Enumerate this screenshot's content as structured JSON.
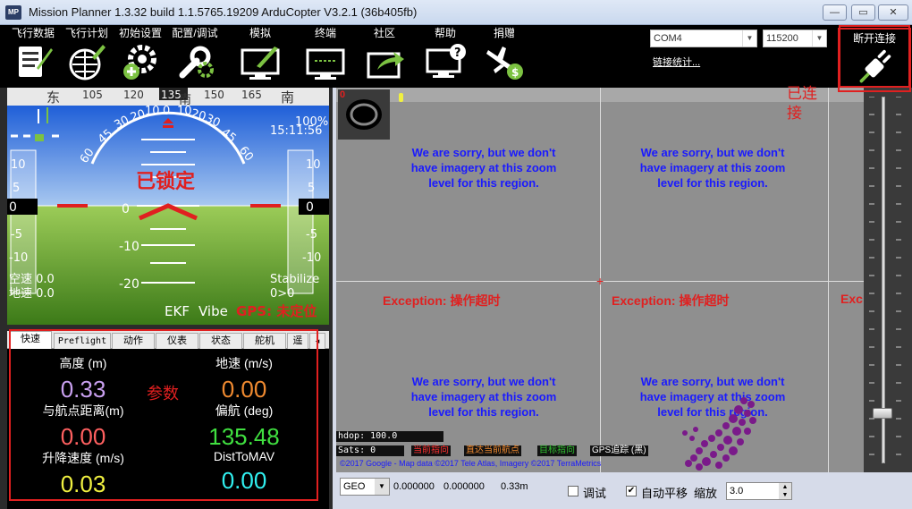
{
  "window": {
    "title": "Mission Planner 1.3.32 build 1.1.5765.19209 ArduCopter V3.2.1 (36b405fb)",
    "icon_text": "MP",
    "minimize": "—",
    "maximize": "▭",
    "close": "✕"
  },
  "toolbar": {
    "items": [
      {
        "label": "飞行数据",
        "icon": "flight-data-icon"
      },
      {
        "label": "飞行计划",
        "icon": "flight-plan-icon"
      },
      {
        "label": "初始设置",
        "icon": "initial-setup-icon"
      },
      {
        "label": "配置/调试",
        "icon": "config-tuning-icon"
      },
      {
        "label": "模拟",
        "icon": "simulation-icon"
      },
      {
        "label": "终端",
        "icon": "terminal-icon"
      },
      {
        "label": "社区",
        "icon": "community-icon"
      },
      {
        "label": "帮助",
        "icon": "help-icon"
      },
      {
        "label": "捐赠",
        "icon": "donate-icon"
      }
    ],
    "port": "COM4",
    "baud": "115200",
    "link_stats": "链接统计...",
    "connect_label": "断开连接"
  },
  "hud": {
    "heading_ticks": [
      "东",
      "105",
      "120",
      "135",
      "南",
      "150",
      "165",
      "南"
    ],
    "pitch_labels": [
      "10",
      "0",
      "-10",
      "-20"
    ],
    "roll_labels": [
      "60",
      "45",
      "30",
      "20",
      "10",
      "0",
      "10",
      "20",
      "30",
      "45",
      "60"
    ],
    "left_scale": [
      "10",
      "5",
      "0",
      "-5",
      "-10"
    ],
    "right_scale": [
      "10",
      "5",
      "0",
      "-5",
      "-10"
    ],
    "left_value": "0",
    "right_value": "0",
    "armed_text": "已锁定",
    "battery": "100%",
    "time": "15:11:56",
    "airspeed": "空速 0.0",
    "groundspeed": "地速 0.0",
    "mode": "Stabilize",
    "wp": "0>0",
    "ekf": "EKF",
    "vibe": "Vibe",
    "gps": "GPS: 未定位"
  },
  "tabs": [
    "快速",
    "Preflight",
    "动作",
    "仪表",
    "状态",
    "舵机",
    "遥"
  ],
  "quick": {
    "cells": [
      {
        "label": "高度 (m)",
        "value": "0.33",
        "color": "#c9a0f0"
      },
      {
        "label": "地速 (m/s)",
        "value": "0.00",
        "color": "#f08a30"
      },
      {
        "label": "与航点距离(m)",
        "value": "0.00",
        "color": "#ff6060"
      },
      {
        "label": "偏航 (deg)",
        "value": "135.48",
        "color": "#40e040"
      },
      {
        "label": "升降速度 (m/s)",
        "value": "0.03",
        "color": "#f0f040"
      },
      {
        "label": "DistToMAV",
        "value": "0.00",
        "color": "#30f0f0"
      }
    ]
  },
  "annotations": {
    "params": "参数",
    "connected": "已连\n接"
  },
  "map": {
    "sorry": "We are sorry, but we don't have imagery at this zoom level for this region.",
    "exception": "Exception: 操作超时",
    "exception_cut": "Exc",
    "zero_badge": "0",
    "hdop": "hdop: 100.0",
    "sats": "Sats: 0",
    "legend": [
      {
        "label": "当前指向",
        "color": "#ff3030"
      },
      {
        "label": "直达当前航点",
        "color": "#f08a30"
      },
      {
        "label": "目标指向",
        "color": "#30c030"
      },
      {
        "label": "GPS追踪 (黑)",
        "color": "#ffffff"
      }
    ],
    "copyright": "©2017 Google - Map data ©2017 Tele Atlas, Imagery ©2017 TerraMetrics"
  },
  "bottom": {
    "map_type": "GEO",
    "lat": "0.000000",
    "lng": "0.000000",
    "alt": "0.33m",
    "debug": "调试",
    "autopan": "自动平移",
    "zoom_label": "缩放",
    "zoom_value": "3.0"
  }
}
